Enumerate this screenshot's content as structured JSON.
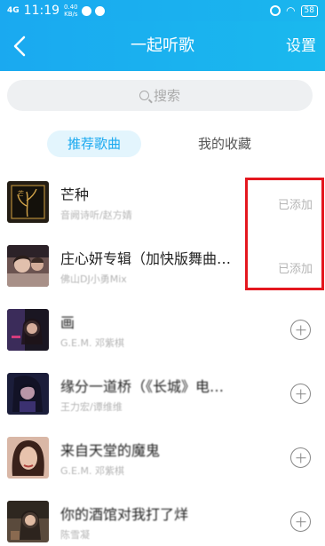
{
  "status_bar": {
    "signal": "4G",
    "time": "11:19",
    "net_speed": "0.40",
    "net_unit": "KB/s",
    "battery": "58"
  },
  "header": {
    "back_icon": "chevron-left-icon",
    "title": "一起听歌",
    "settings_label": "设置"
  },
  "search": {
    "placeholder": "搜索",
    "icon": "search-icon"
  },
  "tabs": [
    {
      "label": "推荐歌曲",
      "active": true
    },
    {
      "label": "我的收藏",
      "active": false
    }
  ],
  "songs": [
    {
      "title": "芒种",
      "artist": "音阙诗听/赵方婧",
      "status": "已添加",
      "added": true
    },
    {
      "title": "庄心妍专辑（加快版舞曲…",
      "artist": "佛山DJ小勇Mix",
      "status": "已添加",
      "added": true
    },
    {
      "title": "画",
      "artist": "G.E.M. 邓紫棋",
      "status": "",
      "added": false
    },
    {
      "title": "缘分一道桥（《长城》电…",
      "artist": "王力宏/谭维维",
      "status": "",
      "added": false
    },
    {
      "title": "来自天堂的魔鬼",
      "artist": "G.E.M. 邓紫棋",
      "status": "",
      "added": false
    },
    {
      "title": "你的酒馆对我打了烊",
      "artist": "陈雪凝",
      "status": "",
      "added": false
    }
  ],
  "colors": {
    "accent": "#1aa9f0",
    "highlight": "#e4171f"
  }
}
